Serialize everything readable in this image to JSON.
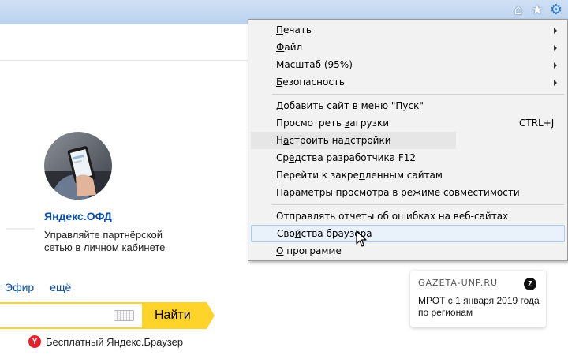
{
  "browser": {
    "toolbar_icons": [
      {
        "name": "home-icon",
        "glyph": "⌂"
      },
      {
        "name": "star-icon",
        "glyph": "★"
      },
      {
        "name": "gear-icon",
        "glyph": "⚙"
      }
    ]
  },
  "page": {
    "ofd": {
      "title": "Яндекс.ОФД",
      "desc_line1": "Управляйте партнёрской",
      "desc_line2": "сетью в личном кабинете"
    },
    "nav": [
      "Эфир",
      "ещё"
    ],
    "search": {
      "value": "",
      "button_label": "Найти"
    },
    "browser_promo": {
      "logo_glyph": "Y",
      "text": "Бесплатный Яндекс.Браузер"
    },
    "news_card": {
      "source": "GAZETA-UNP.RU",
      "badge": "Z",
      "text": "МРОТ с 1 января 2019 года по регионам"
    }
  },
  "menu": {
    "items": [
      {
        "key": "print",
        "accel": "П",
        "rest": "ечать",
        "has_submenu": true
      },
      {
        "key": "file",
        "accel": "Ф",
        "rest": "айл",
        "has_submenu": true
      },
      {
        "key": "zoom",
        "pre": "Мас",
        "accel": "ш",
        "rest": "таб (95%)",
        "has_submenu": true
      },
      {
        "key": "security",
        "accel": "Б",
        "rest": "езопасность",
        "has_submenu": true
      },
      {
        "key": "add-to-start",
        "label": "Добавить сайт в меню \"Пуск\""
      },
      {
        "key": "view-downloads",
        "pre": "Просмотреть ",
        "accel": "з",
        "rest": "агрузки",
        "shortcut": "CTRL+J"
      },
      {
        "key": "manage-addons",
        "pre": "Н",
        "accel": "а",
        "rest": "строить надстройки"
      },
      {
        "key": "devtools",
        "pre": "Ср",
        "accel": "е",
        "rest": "дства разработчика F12"
      },
      {
        "key": "pinned-sites",
        "pre": "Перейти к закре",
        "accel": "п",
        "rest": "ленным сайтам"
      },
      {
        "key": "compat-view",
        "label": "Параметры просмотра в режиме совместимости"
      },
      {
        "key": "report-errors",
        "label": "Отправлять отчеты об ошибках на веб-сайтах"
      },
      {
        "key": "browser-properties",
        "pre": "Сво",
        "accel": "й",
        "rest": "ства браузера"
      },
      {
        "key": "about",
        "accel": "О",
        "rest": " программе"
      }
    ]
  }
}
